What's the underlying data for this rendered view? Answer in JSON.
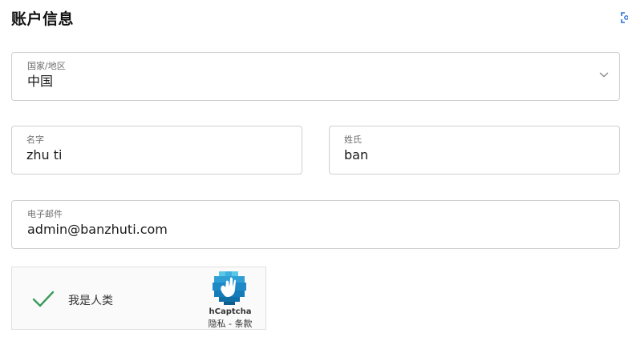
{
  "section": {
    "title": "账户信息"
  },
  "country": {
    "label": "国家/地区",
    "value": "中国"
  },
  "first_name": {
    "label": "名字",
    "value": "zhu ti"
  },
  "last_name": {
    "label": "姓氏",
    "value": "ban"
  },
  "email": {
    "label": "电子邮件",
    "value": "admin@banzhuti.com"
  },
  "captcha": {
    "label": "我是人类",
    "brand": "hCaptcha",
    "links": "隐私 - 条款",
    "check_color": "#3a9a5b",
    "logo_color": "#0f7bb8"
  },
  "icons": {
    "corner": "scan-icon",
    "dropdown": "chevron-down-icon",
    "check": "check-icon",
    "logo": "hcaptcha-logo-icon"
  }
}
